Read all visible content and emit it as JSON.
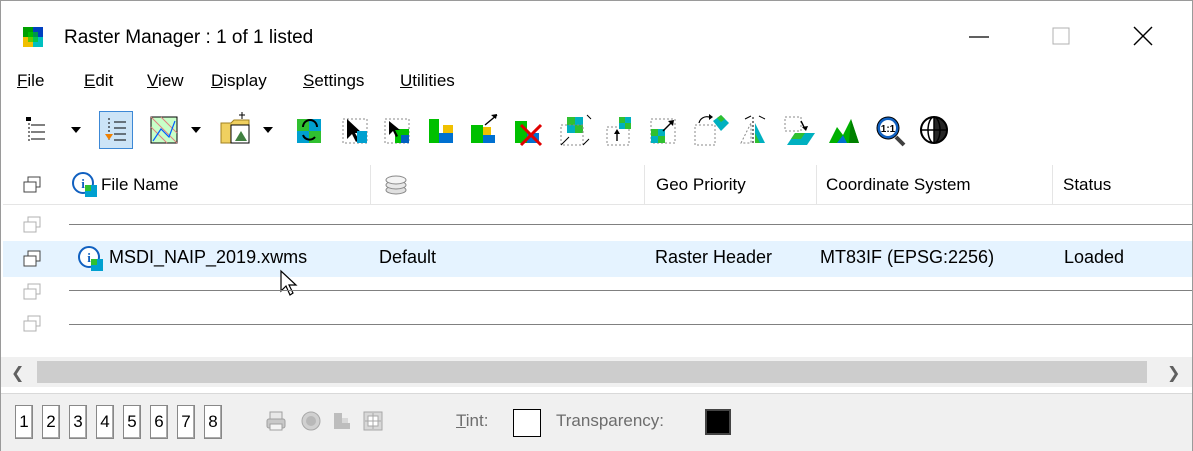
{
  "window": {
    "title": "Raster Manager : 1 of 1 listed",
    "controls": {
      "minimize": "—",
      "maximize": "☐",
      "close": "✕"
    }
  },
  "menu": {
    "items": [
      {
        "label": "File",
        "u": "F",
        "rest": "ile"
      },
      {
        "label": "Edit",
        "u": "E",
        "rest": "dit"
      },
      {
        "label": "View",
        "u": "V",
        "rest": "iew"
      },
      {
        "label": "Display",
        "u": "D",
        "rest": "isplay"
      },
      {
        "label": "Settings",
        "u": "S",
        "rest": "ettings"
      },
      {
        "label": "Utilities",
        "u": "U",
        "rest": "tilities"
      }
    ]
  },
  "toolbar": {
    "icons": [
      "tree-view-icon",
      "list-view-icon",
      "raster-attach-icon",
      "open-folder-icon",
      "refresh-icon",
      "select-icon",
      "green-raster-icon",
      "raster-export-icon",
      "detach-icon",
      "transform-icon",
      "move-icon",
      "scale-icon",
      "rotate-icon",
      "mirror-icon",
      "warp-icon",
      "elevation-icon",
      "zoom-1-1-icon",
      "globe-icon"
    ]
  },
  "columns": {
    "file_name": "File Name",
    "geo_priority": "Geo Priority",
    "coordinate_system": "Coordinate System",
    "status": "Status"
  },
  "rows": [
    {
      "file_name": "MSDI_NAIP_2019.xwms",
      "logical": "Default",
      "geo_priority": "Raster Header",
      "coordinate_system": "MT83IF (EPSG:2256)",
      "status": "Loaded"
    }
  ],
  "bottom": {
    "views": [
      "1",
      "2",
      "3",
      "4",
      "5",
      "6",
      "7",
      "8"
    ],
    "tint_label": "Tint:",
    "tint_underline": "T",
    "tint_rest": "int:",
    "transparency_label": "Transparency:"
  },
  "colors": {
    "selection": "#e5f3ff",
    "accent": "#3c88d6"
  }
}
